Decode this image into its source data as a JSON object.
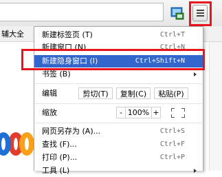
{
  "bookmark_bar": {
    "partial_text": "辅大全"
  },
  "menu": {
    "new_tab": {
      "label": "新建标签页 (T)",
      "shortcut": "Ctrl+T"
    },
    "new_window": {
      "label": "新建窗口 (N)",
      "shortcut": "Ctrl+N"
    },
    "new_incognito": {
      "label": "新建隐身窗口 (I)",
      "shortcut": "Ctrl+Shift+N"
    },
    "bookmarks": {
      "label": "书签 (B)"
    },
    "edit": {
      "label": "编辑",
      "cut": "剪切(T)",
      "copy": "复制(C)",
      "paste": "粘贴(P)"
    },
    "zoom": {
      "label": "缩放",
      "minus": "-",
      "value": "100%",
      "plus": "+"
    },
    "save_as": {
      "label": "网页另存为 (A)...",
      "shortcut": "Ctrl+S"
    },
    "find": {
      "label": "查找 (F)...",
      "shortcut": "Ctrl+F"
    },
    "print": {
      "label": "打印 (P)...",
      "shortcut": "Ctrl+P"
    },
    "tools": {
      "label": "工具 (L)"
    }
  },
  "colors": {
    "selected_bg": "#3366cc",
    "highlight_border": "#e8141c"
  },
  "icons": [
    "extension-icon",
    "menu-hamburger-icon",
    "submenu-arrow-icon",
    "fullscreen-icon"
  ]
}
